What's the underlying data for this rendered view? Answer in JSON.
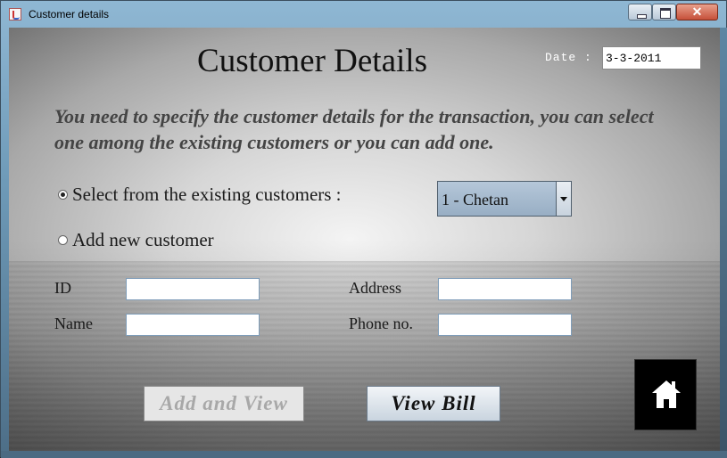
{
  "window": {
    "title": "Customer details",
    "controls": {
      "minimize": "minimize",
      "maximize": "maximize",
      "close": "✕"
    }
  },
  "header": {
    "title": "Customer Details",
    "date_label": "Date :",
    "date_value": "3-3-2011"
  },
  "instructions": "You need to specify the customer details for the transaction, you can select one among the existing customers or you can add one.",
  "options": {
    "existing_label": "Select from the existing customers :",
    "existing_selected": true,
    "new_label": "Add new customer",
    "new_selected": false,
    "customer_combo_value": "1 - Chetan"
  },
  "fields": {
    "id_label": "ID",
    "name_label": "Name",
    "address_label": "Address",
    "phone_label": "Phone no.",
    "id_value": "",
    "name_value": "",
    "address_value": "",
    "phone_value": ""
  },
  "buttons": {
    "add_and_view": "Add and View",
    "view_bill": "View Bill",
    "home_icon": "home-icon"
  },
  "colors": {
    "combo_bg": "#a9bdd1",
    "home_button_bg": "#000000",
    "date_label": "#ffffff"
  }
}
